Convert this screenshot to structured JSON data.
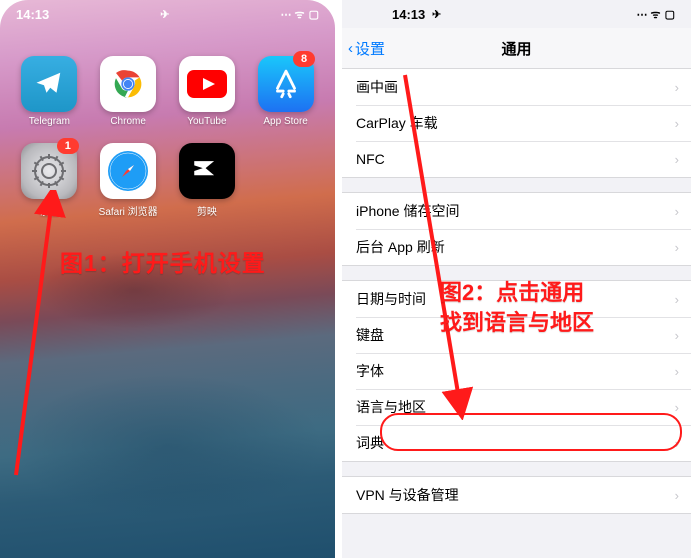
{
  "time": "14:13",
  "annotations": {
    "fig1": "图1：打开手机设置",
    "fig2_line1": "图2：点击通用",
    "fig2_line2": "找到语言与地区"
  },
  "home": {
    "apps": [
      {
        "name": "Telegram",
        "badge": null,
        "kind": "telegram"
      },
      {
        "name": "Chrome",
        "badge": null,
        "kind": "chrome"
      },
      {
        "name": "YouTube",
        "badge": null,
        "kind": "youtube"
      },
      {
        "name": "App Store",
        "badge": "8",
        "kind": "appstore"
      },
      {
        "name": "设置",
        "badge": "1",
        "kind": "settings"
      },
      {
        "name": "Safari 浏览器",
        "badge": null,
        "kind": "safari"
      },
      {
        "name": "剪映",
        "badge": null,
        "kind": "capcut"
      }
    ]
  },
  "settings": {
    "back": "设置",
    "title": "通用",
    "groups": [
      [
        "画中画",
        "CarPlay 车载",
        "NFC"
      ],
      [
        "iPhone 储存空间",
        "后台 App 刷新"
      ],
      [
        "日期与时间",
        "键盘",
        "字体",
        "语言与地区",
        "词典"
      ],
      [
        "VPN 与设备管理"
      ]
    ]
  }
}
